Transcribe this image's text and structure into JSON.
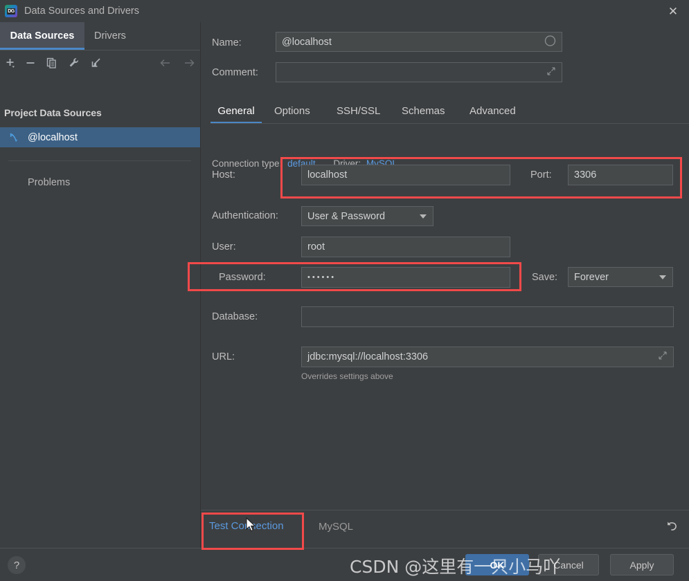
{
  "window": {
    "title": "Data Sources and Drivers",
    "app_icon": "datagrip-icon",
    "logo_text": "DG",
    "close_label": "✕"
  },
  "sidebar": {
    "tabs": [
      {
        "label": "Data Sources",
        "active": true
      },
      {
        "label": "Drivers",
        "active": false
      }
    ],
    "toolbar": [
      {
        "name": "add-icon",
        "title": "+"
      },
      {
        "name": "remove-icon",
        "title": "−"
      },
      {
        "name": "duplicate-icon",
        "title": "copy"
      },
      {
        "name": "properties-wrench-icon",
        "title": "wrench"
      },
      {
        "name": "import-icon",
        "title": "import"
      },
      {
        "name": "back-arrow-icon",
        "title": "←"
      },
      {
        "name": "forward-arrow-icon",
        "title": "→"
      }
    ],
    "section_title": "Project Data Sources",
    "data_source": {
      "label": "@localhost",
      "icon": "mysql-dolphin-icon",
      "selected": true
    },
    "problems_label": "Problems"
  },
  "form": {
    "name": {
      "label": "Name:",
      "value": "@localhost",
      "placeholder": "",
      "trailing_icon": "circle-toggle-icon"
    },
    "comment": {
      "label": "Comment:",
      "value": "",
      "placeholder": "",
      "trailing_icon": "expand-arrow-icon"
    },
    "tabs": [
      {
        "label": "General",
        "active": true
      },
      {
        "label": "Options",
        "active": false
      },
      {
        "label": "SSH/SSL",
        "active": false
      },
      {
        "label": "Schemas",
        "active": false
      },
      {
        "label": "Advanced",
        "active": false
      }
    ],
    "connection_type_label": "Connection type:",
    "connection_type_value": "default",
    "driver_label": "Driver:",
    "driver_value": "MySQL",
    "host": {
      "label": "Host:",
      "value": "localhost"
    },
    "port": {
      "label": "Port:",
      "value": "3306"
    },
    "authentication": {
      "label": "Authentication:",
      "value": "User & Password"
    },
    "user": {
      "label": "User:",
      "value": "root"
    },
    "password": {
      "label": "Password:",
      "value": "••••••"
    },
    "save": {
      "label": "Save:",
      "value": "Forever"
    },
    "database": {
      "label": "Database:",
      "value": ""
    },
    "url": {
      "label": "URL:",
      "value": "jdbc:mysql://localhost:3306",
      "trailing_icon": "expand-arrow-icon"
    },
    "url_hint": "Overrides settings above"
  },
  "footer": {
    "test_connection": "Test Connection",
    "driver_name": "MySQL",
    "revert_icon": "revert-undo-icon",
    "help_label": "?",
    "buttons": [
      {
        "label": "OK",
        "primary": true
      },
      {
        "label": "Cancel",
        "primary": false
      },
      {
        "label": "Apply",
        "primary": false
      }
    ]
  },
  "annotations": {
    "highlight_color": "#f2494a",
    "boxes": [
      {
        "name": "host-port-highlight"
      },
      {
        "name": "password-highlight"
      },
      {
        "name": "test-connection-highlight"
      }
    ]
  },
  "watermark": {
    "text": "CSDN @这里有一只小马吖"
  }
}
